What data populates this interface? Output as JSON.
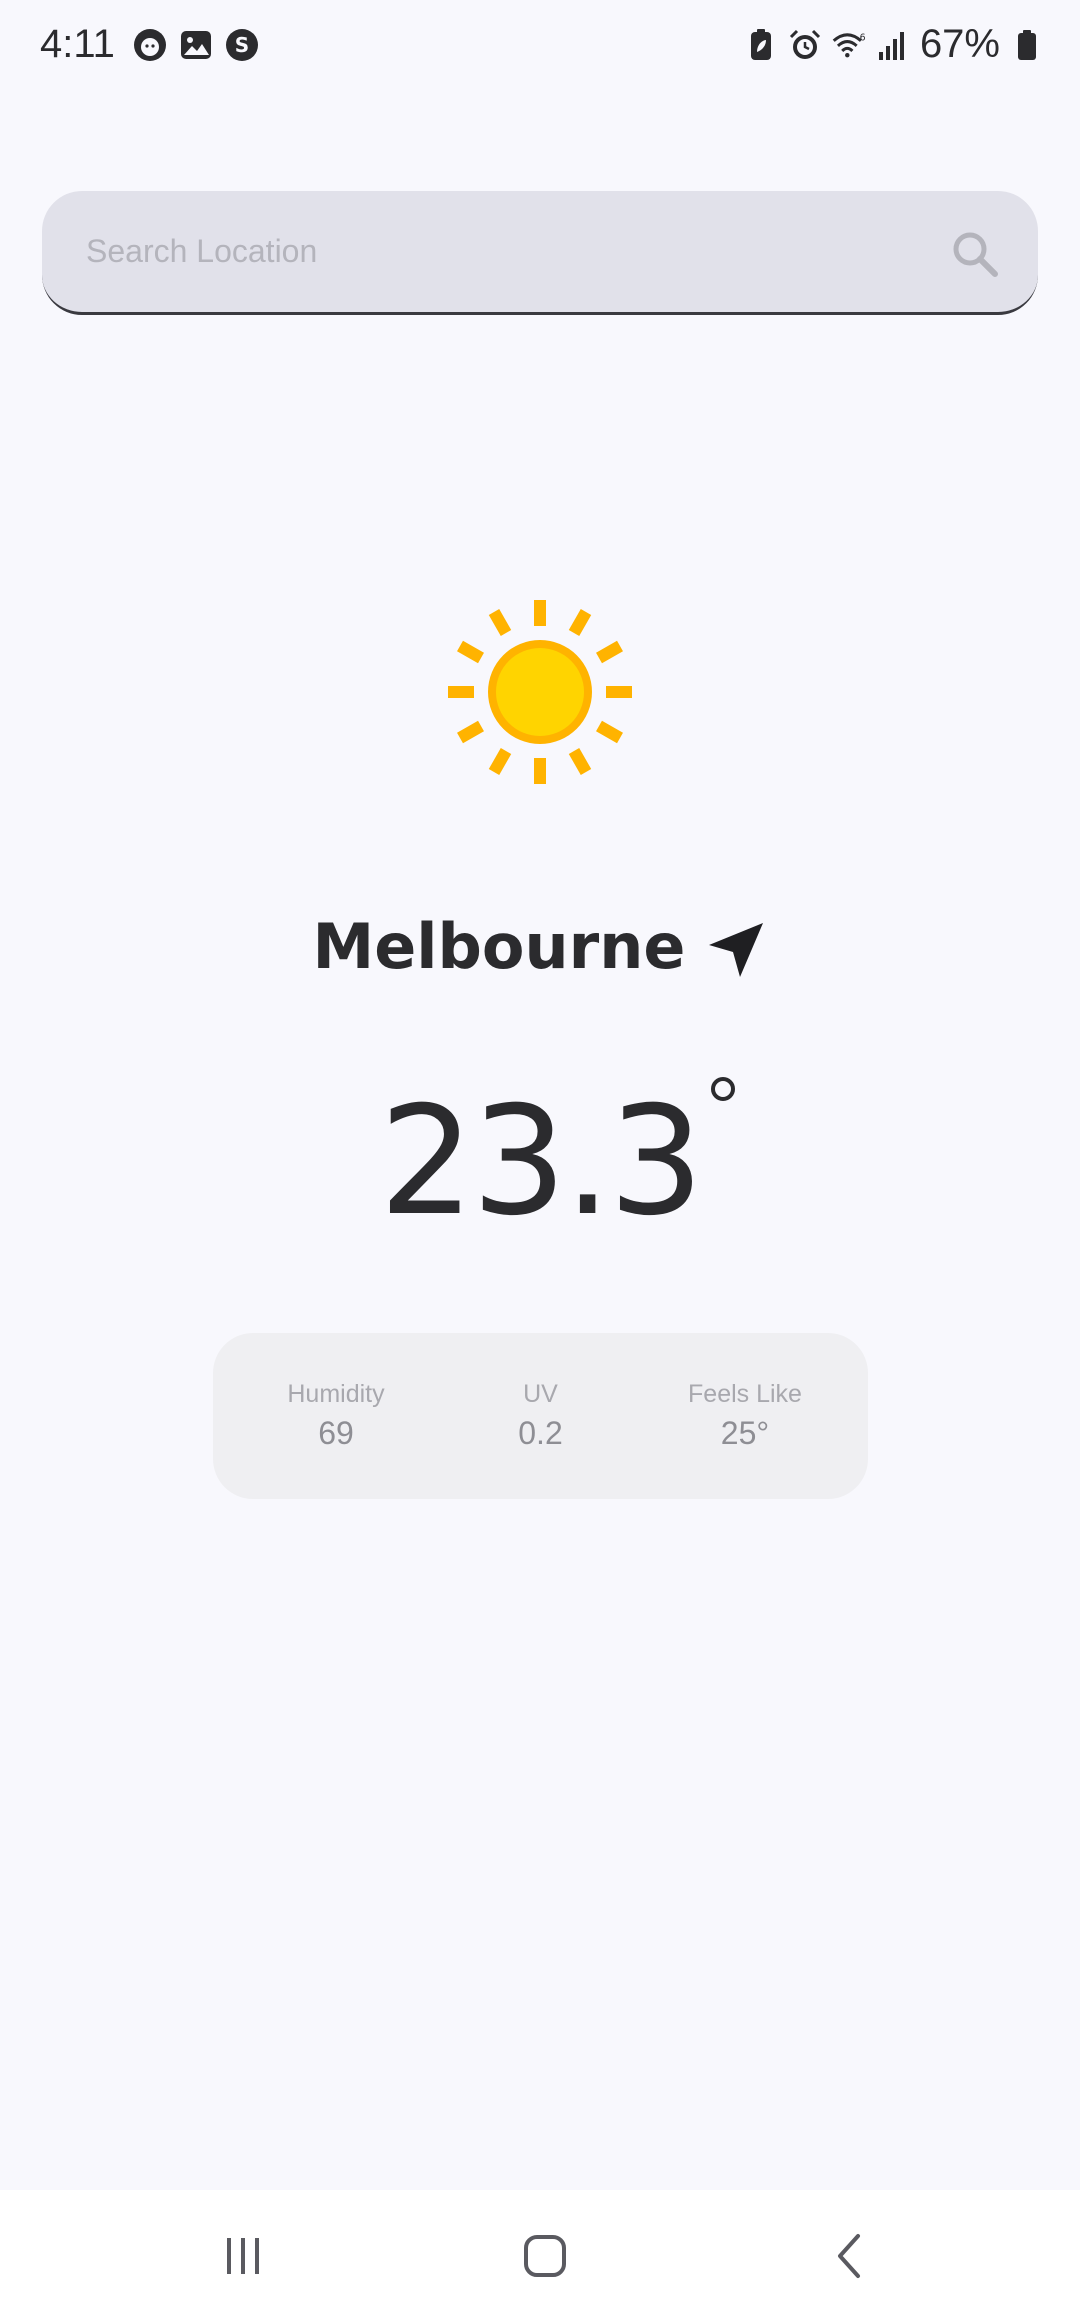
{
  "status_bar": {
    "time": "4:11",
    "battery_percent": "67%",
    "icons_left": [
      "cat-face-icon",
      "gallery-icon",
      "s-app-icon"
    ],
    "icons_right": [
      "battery-saver-icon",
      "alarm-icon",
      "wifi-icon",
      "signal-icon",
      "battery-icon"
    ]
  },
  "search": {
    "placeholder": "Search Location",
    "value": ""
  },
  "weather": {
    "icon": "sun-icon",
    "city": "Melbourne",
    "location_icon": "location-arrow-icon",
    "temperature": "23.3",
    "colors": {
      "sun_core": "#ffd400",
      "sun_rays": "#ffb300",
      "text": "#2b2b2e"
    }
  },
  "stats": [
    {
      "label": "Humidity",
      "value": "69"
    },
    {
      "label": "UV",
      "value": "0.2"
    },
    {
      "label": "Feels Like",
      "value": "25°"
    }
  ],
  "nav": {
    "icons": [
      "recent-apps-icon",
      "home-icon",
      "back-icon"
    ]
  }
}
